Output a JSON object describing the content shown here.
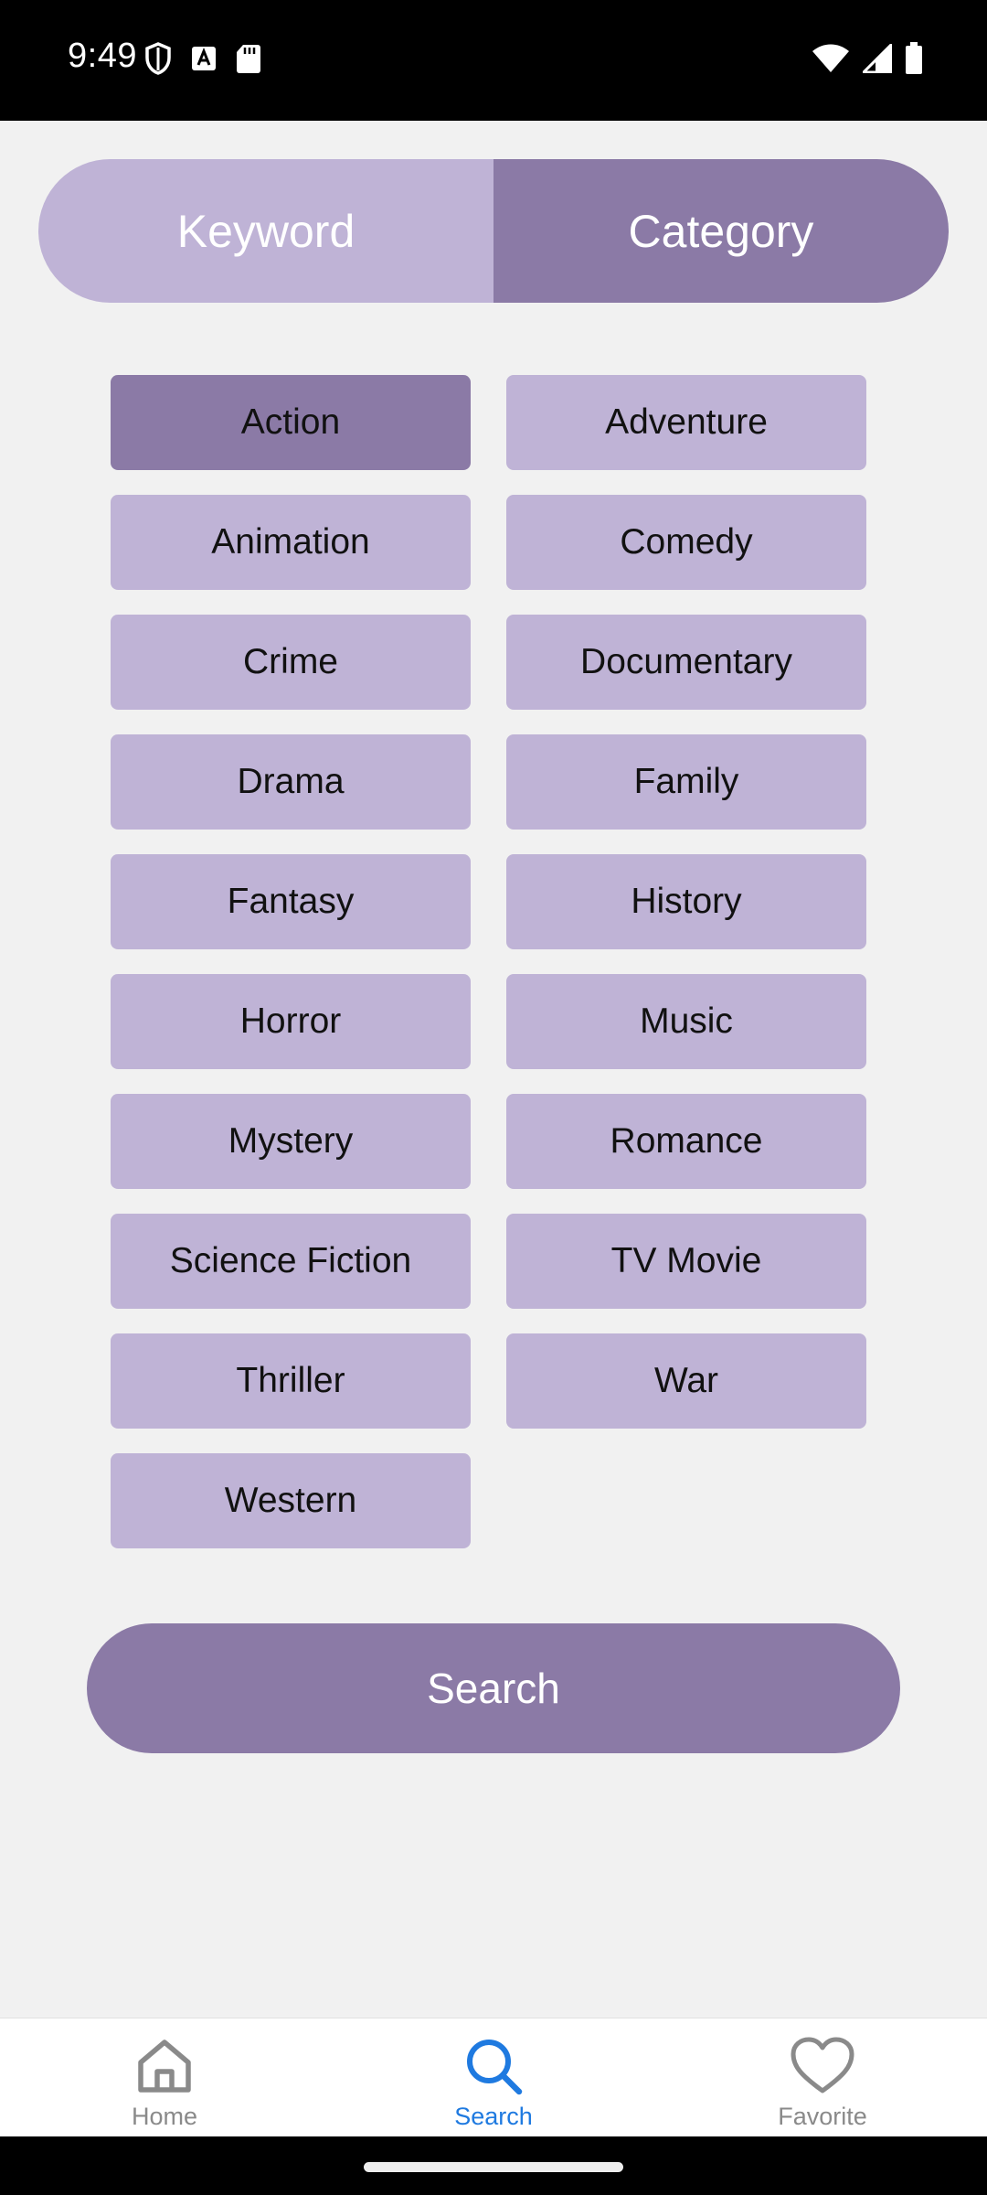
{
  "status_bar": {
    "time": "9:49",
    "left_icons": [
      "shield-icon",
      "a-keyboard-icon",
      "sd-card-icon"
    ],
    "right_icons": [
      "wifi-icon",
      "signal-icon",
      "battery-icon"
    ]
  },
  "search_mode": {
    "tabs": [
      {
        "label": "Keyword",
        "active": false
      },
      {
        "label": "Category",
        "active": true
      }
    ]
  },
  "categories": {
    "items": [
      {
        "label": "Action",
        "selected": true
      },
      {
        "label": "Adventure",
        "selected": false
      },
      {
        "label": "Animation",
        "selected": false
      },
      {
        "label": "Comedy",
        "selected": false
      },
      {
        "label": "Crime",
        "selected": false
      },
      {
        "label": "Documentary",
        "selected": false
      },
      {
        "label": "Drama",
        "selected": false
      },
      {
        "label": "Family",
        "selected": false
      },
      {
        "label": "Fantasy",
        "selected": false
      },
      {
        "label": "History",
        "selected": false
      },
      {
        "label": "Horror",
        "selected": false
      },
      {
        "label": "Music",
        "selected": false
      },
      {
        "label": "Mystery",
        "selected": false
      },
      {
        "label": "Romance",
        "selected": false
      },
      {
        "label": "Science Fiction",
        "selected": false
      },
      {
        "label": "TV Movie",
        "selected": false
      },
      {
        "label": "Thriller",
        "selected": false
      },
      {
        "label": "War",
        "selected": false
      },
      {
        "label": "Western",
        "selected": false
      }
    ]
  },
  "search_button": {
    "label": "Search"
  },
  "bottom_nav": {
    "items": [
      {
        "label": "Home",
        "icon": "home-icon",
        "active": false
      },
      {
        "label": "Search",
        "icon": "search-icon",
        "active": true
      },
      {
        "label": "Favorite",
        "icon": "heart-icon",
        "active": false
      }
    ]
  },
  "colors": {
    "accent_active": "#8b7aa6",
    "accent_inactive": "#bfb3d6",
    "nav_active": "#1f7ae0",
    "nav_inactive": "#8a8a8a"
  }
}
